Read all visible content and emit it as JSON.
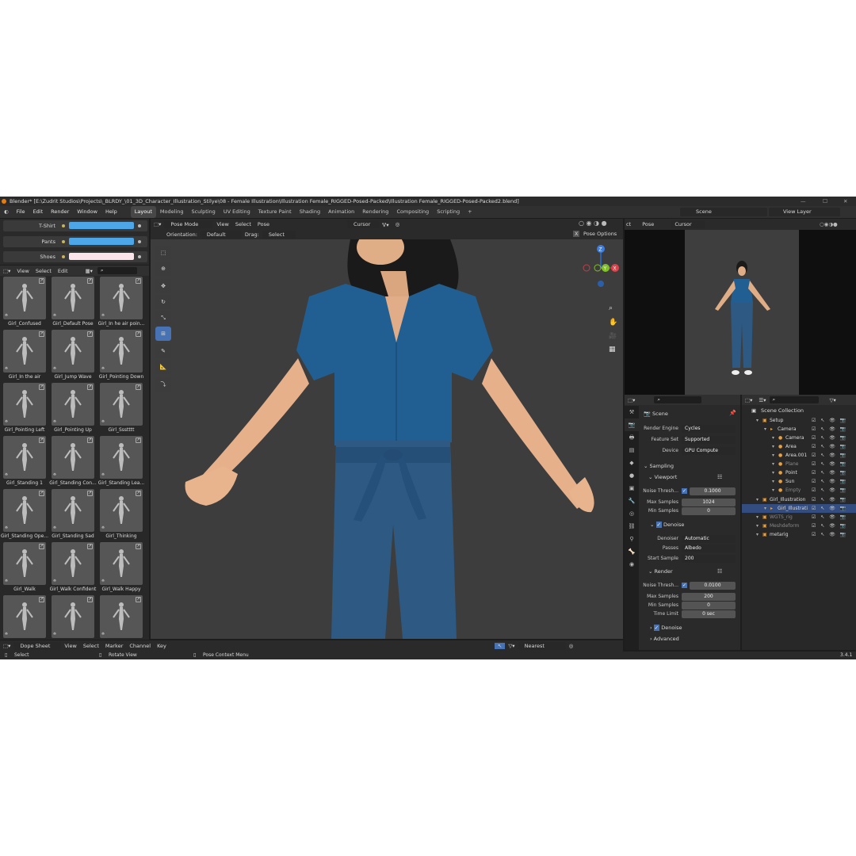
{
  "title": "Blender* [E:\\Zudrit Studios\\Projects\\_BLRDY_\\01_3D_Character_Illustration_Stilye\\08 - Female Illustration\\Illustration Female_RIGGED-Posed-Packed\\Illustration Female_RIGGED-Posed-Packed2.blend]",
  "menu": [
    "File",
    "Edit",
    "Render",
    "Window",
    "Help"
  ],
  "workspaces": [
    "Layout",
    "Modeling",
    "Sculpting",
    "UV Editing",
    "Texture Paint",
    "Shading",
    "Animation",
    "Rendering",
    "Compositing",
    "Scripting"
  ],
  "active_workspace": "Layout",
  "scene_name": "Scene",
  "view_layer": "View Layer",
  "colors": {
    "tshirt": "#4da6e8",
    "pants": "#4da6e8",
    "shoes": "#fbe4ea",
    "accent": "#4772b3",
    "highlight": "#334d80"
  },
  "color_props": [
    {
      "label": "T-Shirt"
    },
    {
      "label": "Pants"
    },
    {
      "label": "Shoes"
    }
  ],
  "asset_browser": {
    "menu": [
      "View",
      "Select",
      "Edit"
    ],
    "items": [
      "Girl_Confused",
      "Girl_Default Pose",
      "Girl_In he air poin...",
      "Girl_In the air",
      "Girl_Jump Wave",
      "Girl_Pointing Down",
      "Girl_Pointing Left",
      "Girl_Pointing Up",
      "Girl_Ssstttt",
      "Girl_Standing 1",
      "Girl_Standing Con...",
      "Girl_Standing Lea...",
      "Girl_Standing Ope...",
      "Girl_Standing Sad",
      "Girl_Thinking",
      "Girl_Walk",
      "Girl_Walk Confident",
      "Girl_Walk Happy",
      "",
      "",
      " "
    ]
  },
  "viewport": {
    "mode": "Pose Mode",
    "menu": [
      "View",
      "Select",
      "Pose"
    ],
    "snap": "Cursor",
    "orientation_label": "Orientation:",
    "orientation": "Default",
    "drag_label": "Drag:",
    "drag": "Select Box",
    "pose_options": "Pose Options",
    "x_mirror": "X",
    "gizmo_x": "X",
    "gizmo_y": "Y",
    "gizmo_z": "Z"
  },
  "camera_view": {
    "menu_partial": "ct",
    "pose": "Pose",
    "snap": "Cursor"
  },
  "properties": {
    "section": "Scene",
    "rows": [
      {
        "label": "Render Engine",
        "value": "Cycles"
      },
      {
        "label": "Feature Set",
        "value": "Supported"
      },
      {
        "label": "Device",
        "value": "GPU Compute"
      }
    ],
    "sampling": "Sampling",
    "viewport": "Viewport",
    "viewport_rows": [
      {
        "label": "Noise Thresh...",
        "value": "0.1000"
      },
      {
        "label": "Max Samples",
        "value": "1024"
      },
      {
        "label": "Min Samples",
        "value": "0"
      }
    ],
    "denoise": "Denoise",
    "denoise_rows": [
      {
        "label": "Denoiser",
        "value": "Automatic"
      },
      {
        "label": "Passes",
        "value": "Albedo"
      },
      {
        "label": "Start Sample",
        "value": "200"
      }
    ],
    "render": "Render",
    "render_rows": [
      {
        "label": "Noise Thresh...",
        "value": "0.0100"
      },
      {
        "label": "Max Samples",
        "value": "200"
      },
      {
        "label": "Min Samples",
        "value": "0"
      },
      {
        "label": "Time Limit",
        "value": "0 sec"
      }
    ],
    "denoise2": "Denoise",
    "advanced": "Advanced"
  },
  "outliner": {
    "root": "Scene Collection",
    "items": [
      {
        "name": "Setup",
        "indent": 1
      },
      {
        "name": "Camera",
        "indent": 2
      },
      {
        "name": "Camera",
        "indent": 3
      },
      {
        "name": "Area",
        "indent": 3
      },
      {
        "name": "Area.001",
        "indent": 3
      },
      {
        "name": "Plane",
        "indent": 3
      },
      {
        "name": "Point",
        "indent": 3
      },
      {
        "name": "Sun",
        "indent": 3
      },
      {
        "name": "Empty",
        "indent": 3
      },
      {
        "name": "Girl_Illustration",
        "indent": 1
      },
      {
        "name": "Girl_Illustrati",
        "indent": 2
      },
      {
        "name": "WGTS_rig",
        "indent": 1
      },
      {
        "name": "Meshdeform",
        "indent": 1
      },
      {
        "name": "metarig",
        "indent": 1
      }
    ]
  },
  "timeline": {
    "editor": "Dope Sheet",
    "menu": [
      "View",
      "Select",
      "Marker",
      "Channel",
      "Key"
    ],
    "snap": "Nearest Frame"
  },
  "status": {
    "select": "Select",
    "rotate": "Rotate View",
    "context": "Pose Context Menu",
    "version": "3.4.1"
  }
}
